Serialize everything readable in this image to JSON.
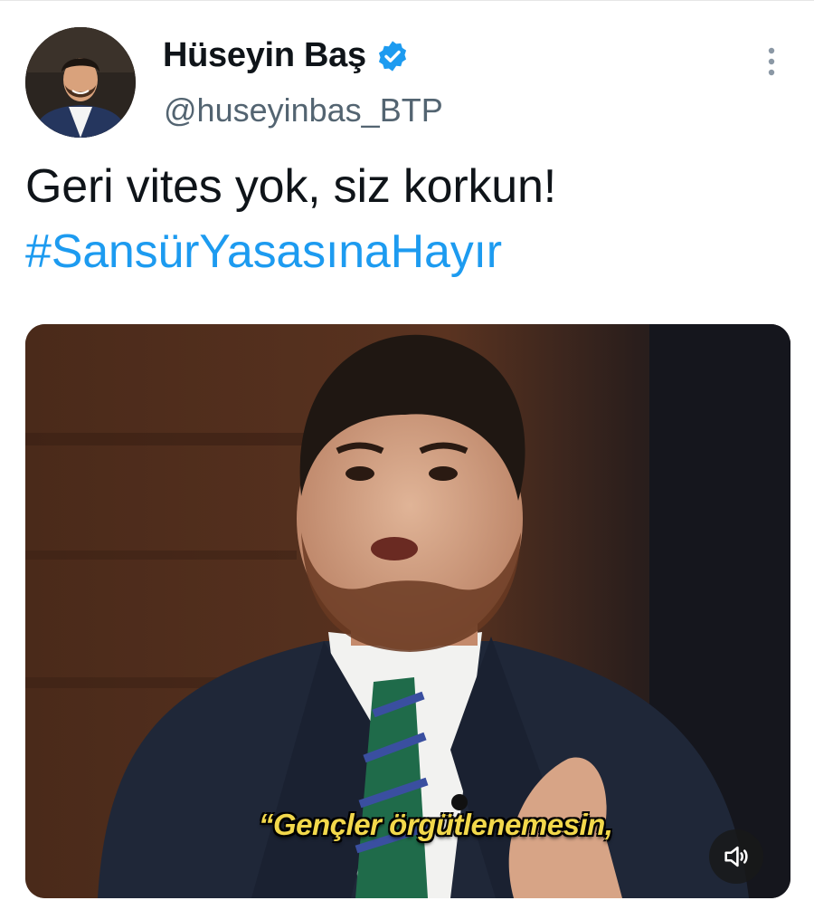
{
  "tweet": {
    "author": {
      "display_name": "Hüseyin Baş",
      "handle": "@huseyinbas_BTP",
      "verified": true
    },
    "text": "Geri vites yok, siz korkun!",
    "hashtag": "#SansürYasasınaHayır",
    "media": {
      "type": "video",
      "caption": "“Gençler örgütlenemesin,",
      "muted": true
    }
  },
  "colors": {
    "link": "#1d9bf0",
    "verified": "#1d9bf0",
    "handle": "#536471",
    "caption": "#f2d84b"
  },
  "icons": [
    "verified-badge-icon",
    "more-options-icon",
    "volume-muted-icon"
  ]
}
